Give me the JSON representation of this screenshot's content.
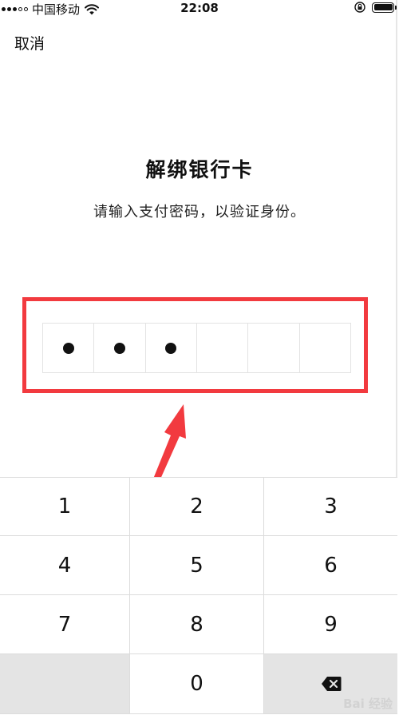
{
  "status_bar": {
    "carrier": "中国移动",
    "time": "22:08"
  },
  "header": {
    "cancel_label": "取消"
  },
  "main": {
    "title": "解绑银行卡",
    "subtitle": "请输入支付密码，以验证身份。",
    "pin_length": 6,
    "pin_filled": 3
  },
  "keypad": {
    "keys": [
      "1",
      "2",
      "3",
      "4",
      "5",
      "6",
      "7",
      "8",
      "9",
      "",
      "0",
      "delete"
    ]
  },
  "watermark": "Bai 经验",
  "colors": {
    "annotation_red": "#f23a3f",
    "keypad_gray": "#e4e4e4"
  },
  "icons": {
    "wifi": "wifi-icon",
    "rotation_lock": "rotation-lock-icon",
    "battery": "battery-icon",
    "delete": "backspace-icon"
  }
}
